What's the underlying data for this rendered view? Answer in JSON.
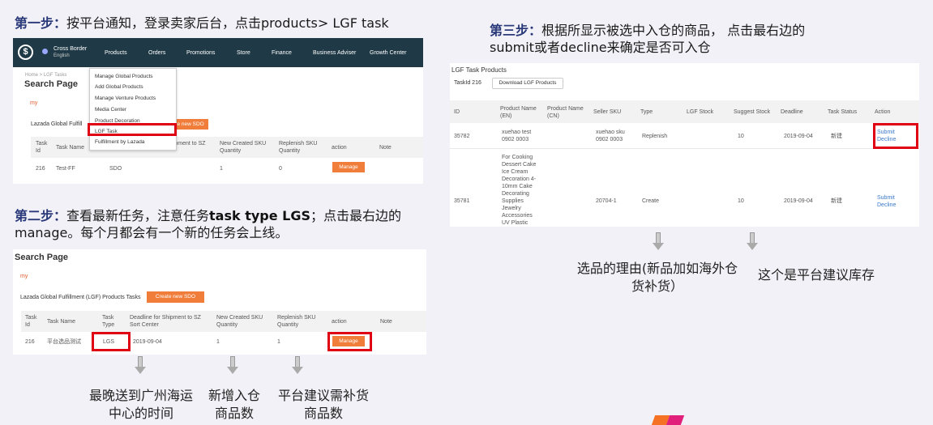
{
  "step1": {
    "label": "第一步：",
    "text": "按平台通知，登录卖家后台，点击products> LGF task"
  },
  "step2": {
    "label": "第二步：",
    "text_a": "查看最新任务，注意任务",
    "text_bold": "task type LGS",
    "text_b": "；点击最右边的manage。每个月都会有一个新的任务会上线。"
  },
  "step3": {
    "label": "第三步：",
    "text": "根据所显示被选中入仓的商品， 点击最右边的submit或者decline来确定是否可入仓"
  },
  "panel1": {
    "brand_title": "Cross Border",
    "brand_sub": "English",
    "nav": [
      "Products",
      "Orders",
      "Promotions",
      "Store",
      "Finance",
      "Business Adviser",
      "Growth Center"
    ],
    "breadcrumb": "Home  >  LGF Tasks",
    "page_title": "Search Page",
    "my": "my",
    "section": "Lazada Global Fulfill",
    "create_btn": "reate new SDO",
    "dropdown": [
      "Manage Global Products",
      "Add Global Products",
      "Manage Venture Products",
      "Media Center",
      "Product Decoration",
      "LGF Task",
      "Fulfillment by Lazada"
    ],
    "headers": [
      "Task Id",
      "Task Name",
      "",
      "r Shipment to SZ",
      "New Created SKU Quantity",
      "Replenish SKU Quantity",
      "action",
      "Note"
    ],
    "row": {
      "id": "216",
      "name": "Test-FF",
      "type": "SDO",
      "qty_new": "1",
      "qty_rep": "0",
      "action": "Manage"
    }
  },
  "panel2": {
    "page_title": "Search Page",
    "my": "my",
    "section": "Lazada Global Fulfillment (LGF) Products Tasks",
    "create_btn": "Create new SDO",
    "headers": [
      "Task Id",
      "Task Name",
      "Task Type",
      "Deadline for Shipment to SZ Sort Center",
      "New Created SKU Quantity",
      "Replenish SKU Quantity",
      "action",
      "Note"
    ],
    "row": {
      "id": "216",
      "name": "平台选品测试",
      "type": "LGS",
      "deadline": "2019-09-04",
      "qty_new": "1",
      "qty_rep": "1",
      "action": "Manage"
    }
  },
  "panel3": {
    "title": "LGF Task Products",
    "task_id": "TaskId 216",
    "download_btn": "Download LGF Products",
    "headers": [
      "ID",
      "Product Name (EN)",
      "Product Name (CN)",
      "Seller SKU",
      "Type",
      "LGF Stock",
      "Suggest Stock",
      "Deadline",
      "Task Status",
      "Action"
    ],
    "rows": [
      {
        "id": "35782",
        "name_en": "xuehao test 0902 0003",
        "name_cn": "",
        "sku": "xuehao sku 0902 0003",
        "type": "Replenish",
        "lgf_stock": "",
        "suggest": "10",
        "deadline": "2019-09-04",
        "status": "新建",
        "submit": "Submit",
        "decline": "Decline"
      },
      {
        "id": "35781",
        "name_en": "For Cooking Dessert Cake Ice Cream Decoration 4-10mm Cake Decorating Supplies Jewelry Accessories UV Plastic Crystal Rotary",
        "name_cn": "",
        "sku": "20704-1",
        "type": "Create",
        "lgf_stock": "",
        "suggest": "10",
        "deadline": "2019-09-04",
        "status": "新建",
        "submit": "Submit",
        "decline": "Decline"
      }
    ]
  },
  "captions": {
    "c1": "最晚送到广州海运中心的时间",
    "c2": "新增入仓商品数",
    "c3": "平台建议需补货商品数",
    "c4": "选品的理由(新品加如海外仓货补货）",
    "c5": "这个是平台建议库存"
  }
}
